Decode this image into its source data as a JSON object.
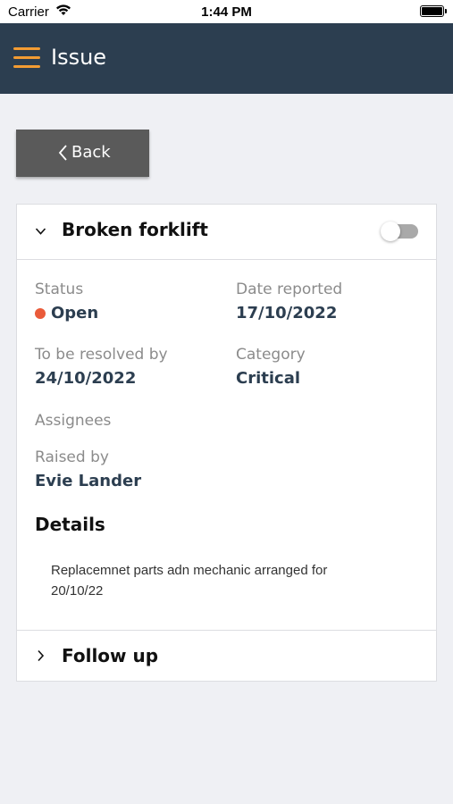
{
  "status_bar": {
    "carrier": "Carrier",
    "time": "1:44 PM"
  },
  "nav": {
    "title": "Issue"
  },
  "back_button": {
    "label": "Back"
  },
  "issue": {
    "title": "Broken forklift",
    "toggle_on": false,
    "status_label": "Status",
    "status_value": "Open",
    "status_color": "#ea5b3a",
    "date_reported_label": "Date reported",
    "date_reported_value": "17/10/2022",
    "resolve_by_label": "To be resolved by",
    "resolve_by_value": "24/10/2022",
    "category_label": "Category",
    "category_value": "Critical",
    "assignees_label": "Assignees",
    "raised_by_label": "Raised by",
    "raised_by_value": "Evie Lander",
    "details_heading": "Details",
    "details_line1": "Replacemnet parts adn mechanic arranged for",
    "details_line2": "20/10/22"
  },
  "follow_up": {
    "title": "Follow up"
  },
  "colors": {
    "navbar": "#2c3e50",
    "accent": "#f39c33",
    "value_text": "#2c3e50"
  }
}
